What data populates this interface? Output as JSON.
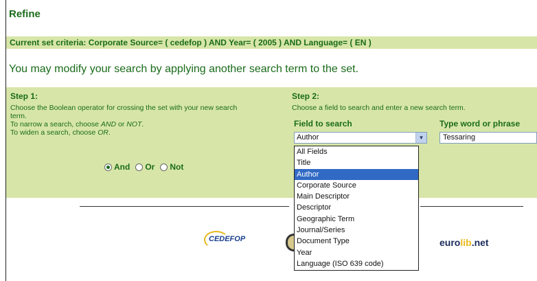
{
  "header": {
    "title": "Refine"
  },
  "criteria": {
    "text": "Current set criteria: Corporate Source= ( cedefop ) AND Year= ( 2005 ) AND Language= ( EN )"
  },
  "modify": {
    "text": "You may modify your search by applying another search term to the set."
  },
  "step1": {
    "title": "Step 1:",
    "line1": "Choose the Boolean operator for crossing the set with your new search",
    "line2": "term.",
    "narrow_prefix": "To narrow a search, choose ",
    "narrow_and": "AND",
    "narrow_or_word": " or ",
    "narrow_not": "NOT",
    "narrow_end": ".",
    "widen_prefix": "To widen a search, choose ",
    "widen_or": "OR",
    "widen_end": ".",
    "operators": [
      {
        "label": "And",
        "checked": true
      },
      {
        "label": "Or",
        "checked": false
      },
      {
        "label": "Not",
        "checked": false
      }
    ]
  },
  "step2": {
    "title": "Step 2:",
    "description": "Choose a field to search and enter a new search term.",
    "field_label": "Field to search",
    "word_label": "Type word or phrase",
    "field_value": "Author",
    "word_value": "Tessaring",
    "options": [
      "All Fields",
      "Title",
      "Author",
      "Corporate Source",
      "Main Descriptor",
      "Descriptor",
      "Geographic Term",
      "Journal/Series",
      "Document Type",
      "Year",
      "Language (ISO 639 code)"
    ],
    "selected_index": 2
  },
  "footer": {
    "cedefop": "CEDEFOP",
    "eurolib_a": "euro",
    "eurolib_b": "lib",
    "eurolib_c": ".net"
  }
}
